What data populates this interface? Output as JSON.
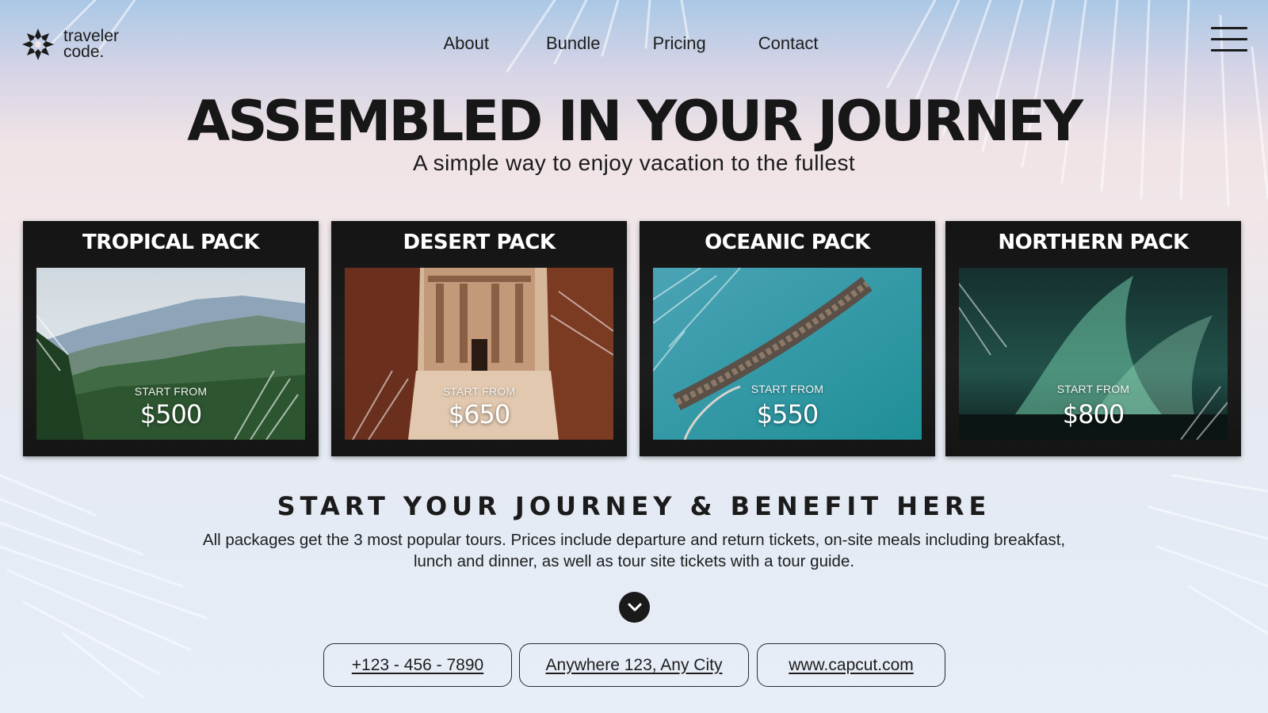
{
  "brand": {
    "name_line1": "traveler",
    "name_line2": "code."
  },
  "nav": {
    "items": [
      "About",
      "Bundle",
      "Pricing",
      "Contact"
    ]
  },
  "hero": {
    "title": "ASSEMBLED IN YOUR JOURNEY",
    "subtitle": "A simple way to enjoy vacation to the fullest"
  },
  "packs": [
    {
      "title": "TROPICAL PACK",
      "start_label": "START FROM",
      "price": "$500",
      "scene": "mountain-forest"
    },
    {
      "title": "DESERT PACK",
      "start_label": "START FROM",
      "price": "$650",
      "scene": "petra-rock-temple"
    },
    {
      "title": "OCEANIC PACK",
      "start_label": "START FROM",
      "price": "$550",
      "scene": "water-villas-pier"
    },
    {
      "title": "NORTHERN PACK",
      "start_label": "START FROM",
      "price": "$800",
      "scene": "aurora-night-sky"
    }
  ],
  "benefit": {
    "title": "START YOUR JOURNEY & BENEFIT HERE",
    "line1": "All packages get the 3 most popular tours. Prices include departure and return tickets, on-site meals including breakfast,",
    "line2": "lunch and dinner, as well as tour site tickets with a tour guide."
  },
  "contacts": {
    "phone": "+123 - 456 - 7890",
    "address": "Anywhere 123, Any City",
    "website": "www.capcut.com"
  },
  "icons": {
    "logo": "starburst-logo-icon",
    "menu": "hamburger-menu-icon",
    "scroll": "chevron-down-icon"
  },
  "colors": {
    "text": "#1c1c1c",
    "card_bg": "#181818",
    "sky_top": "#aac8e6",
    "blush": "#f1e6e8"
  }
}
